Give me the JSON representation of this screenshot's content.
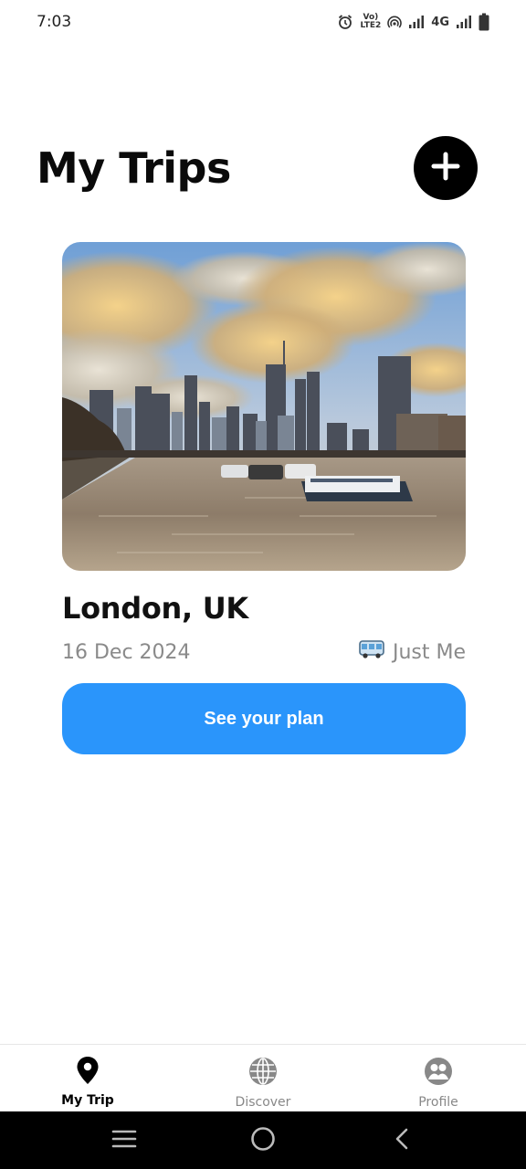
{
  "status_bar": {
    "time": "7:03",
    "volte_top": "Vo)",
    "volte_bottom": "LTE2",
    "network": "4G",
    "icons": [
      "alarm-icon",
      "volte-icon",
      "hotspot-icon",
      "signal-icon",
      "signal-icon",
      "battery-icon"
    ]
  },
  "header": {
    "title": "My Trips",
    "add_icon": "plus-icon"
  },
  "trip": {
    "image_icon": "city-skyline-photo",
    "title": "London, UK",
    "date": "16 Dec 2024",
    "companions_icon": "bus-icon",
    "companions": "Just Me",
    "cta_label": "See your plan"
  },
  "bottom_nav": {
    "items": [
      {
        "label": "My Trip",
        "icon": "location-pin-icon",
        "active": true
      },
      {
        "label": "Discover",
        "icon": "globe-icon",
        "active": false
      },
      {
        "label": "Profile",
        "icon": "profile-icon",
        "active": false
      }
    ]
  },
  "system_nav": {
    "icons": [
      "menu-icon",
      "home-icon",
      "back-icon"
    ]
  },
  "colors": {
    "accent": "#2a95fb",
    "muted_text": "#8a8a8a",
    "title_text": "#0a0a0a"
  }
}
